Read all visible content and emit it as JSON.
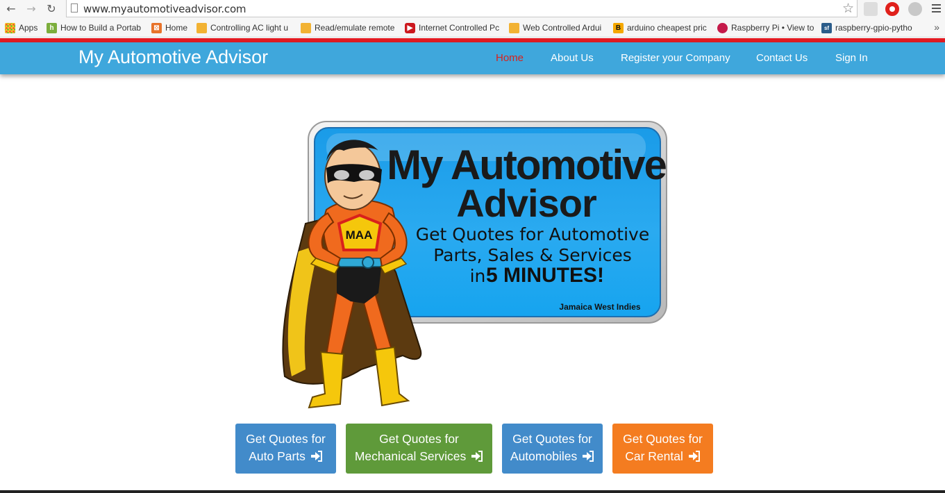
{
  "browser": {
    "url": "www.myautomotiveadvisor.com",
    "bookmarks": [
      {
        "label": "Apps",
        "icon": "apps-grid-icon"
      },
      {
        "label": "How to Build a Portab",
        "icon": "instructables-icon"
      },
      {
        "label": "Home",
        "icon": "home-bookmark-icon"
      },
      {
        "label": "Controlling AC light u",
        "icon": "robot-icon"
      },
      {
        "label": "Read/emulate remote",
        "icon": "robot-icon"
      },
      {
        "label": "Internet Controlled Pc",
        "icon": "youtube-icon"
      },
      {
        "label": "Web Controlled Ardui",
        "icon": "robot-icon"
      },
      {
        "label": "arduino cheapest pric",
        "icon": "banggood-icon"
      },
      {
        "label": "Raspberry Pi • View to",
        "icon": "raspberry-icon"
      },
      {
        "label": "raspberry-gpio-pytho",
        "icon": "sourceforge-icon"
      }
    ],
    "more": "»"
  },
  "site": {
    "brand": "My Automotive Advisor",
    "nav": [
      {
        "label": "Home",
        "active": true
      },
      {
        "label": "About Us",
        "active": false
      },
      {
        "label": "Register your Company",
        "active": false
      },
      {
        "label": "Contact Us",
        "active": false
      },
      {
        "label": "Sign In",
        "active": false
      }
    ]
  },
  "hero": {
    "title_line1": "My Automotive",
    "title_line2": "Advisor",
    "tagline_line1": "Get Quotes for Automotive",
    "tagline_line2": "Parts, Sales & Services",
    "tagline_in": "in",
    "tagline_emphasis": "5 MINUTES!",
    "location": "Jamaica West Indies",
    "badge": "MAA"
  },
  "buttons": [
    {
      "line1": "Get Quotes for",
      "line2": "Auto Parts",
      "color": "#428bca"
    },
    {
      "line1": "Get Quotes for",
      "line2": "Mechanical Services",
      "color": "#5f9a3a"
    },
    {
      "line1": "Get Quotes for",
      "line2": "Automobiles",
      "color": "#428bca"
    },
    {
      "line1": "Get Quotes for",
      "line2": "Car Rental",
      "color": "#f47c20"
    }
  ],
  "colors": {
    "navbar": "#3fa7dc",
    "accent_red": "#e31b23",
    "active_nav": "#d9211b"
  }
}
